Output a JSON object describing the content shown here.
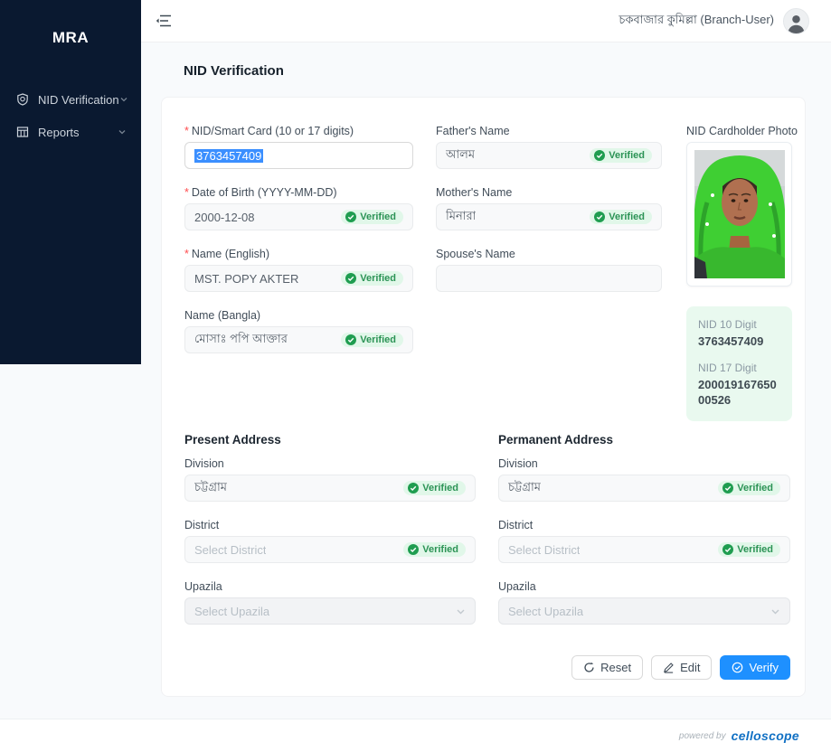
{
  "sidebar": {
    "logo": "MRA",
    "items": [
      {
        "label": "NID Verification",
        "icon": "shield-icon"
      },
      {
        "label": "Reports",
        "icon": "table-icon"
      }
    ]
  },
  "header": {
    "user": "চকবাজার কুমিল্লা (Branch-User)",
    "icons": [
      "menu-fold-icon",
      "avatar"
    ]
  },
  "page": {
    "title": "NID Verification"
  },
  "labels": {
    "verified": "Verified"
  },
  "form": {
    "nid": {
      "label": "NID/Smart Card (10 or 17 digits)",
      "required": true,
      "value": "3763457409"
    },
    "dob": {
      "label": "Date of Birth (YYYY-MM-DD)",
      "required": true,
      "value": "2000-12-08",
      "verified": true
    },
    "name_en": {
      "label": "Name (English)",
      "required": true,
      "value": "MST. POPY AKTER",
      "verified": true
    },
    "name_bn": {
      "label": "Name (Bangla)",
      "value": "মোসাঃ পপি আক্তার",
      "verified": true
    },
    "father": {
      "label": "Father's Name",
      "value": "আলম",
      "verified": true
    },
    "mother": {
      "label": "Mother's Name",
      "value": "মিনারা",
      "verified": true
    },
    "spouse": {
      "label": "Spouse's Name",
      "value": ""
    },
    "photo_label": "NID Cardholder Photo",
    "nid_summary": {
      "nid10_label": "NID 10 Digit",
      "nid10": "3763457409",
      "nid17_label": "NID 17 Digit",
      "nid17": "20001916765000526"
    },
    "present": {
      "heading": "Present Address",
      "division_label": "Division",
      "division": "চট্টগ্রাম",
      "district_label": "District",
      "district_placeholder": "Select District",
      "upazila_label": "Upazila",
      "upazila_placeholder": "Select Upazila"
    },
    "permanent": {
      "heading": "Permanent Address",
      "division_label": "Division",
      "division": "চট্টগ্রাম",
      "district_label": "District",
      "district_placeholder": "Select District",
      "upazila_label": "Upazila",
      "upazila_placeholder": "Select Upazila"
    },
    "buttons": {
      "reset": "Reset",
      "edit": "Edit",
      "verify": "Verify"
    }
  },
  "footer": {
    "powered": "powered by",
    "brand": "celloscope"
  },
  "colors": {
    "sidebar_bg": "#0a1930",
    "accent_blue": "#1e90ff",
    "selection_blue": "#3b8fff",
    "verified_bg": "#e1f7e9",
    "verified_green": "#2b9355",
    "nid_box_bg": "#e9f9ef",
    "brand_blue": "#1271c4",
    "required_red": "#ff4d4f"
  }
}
